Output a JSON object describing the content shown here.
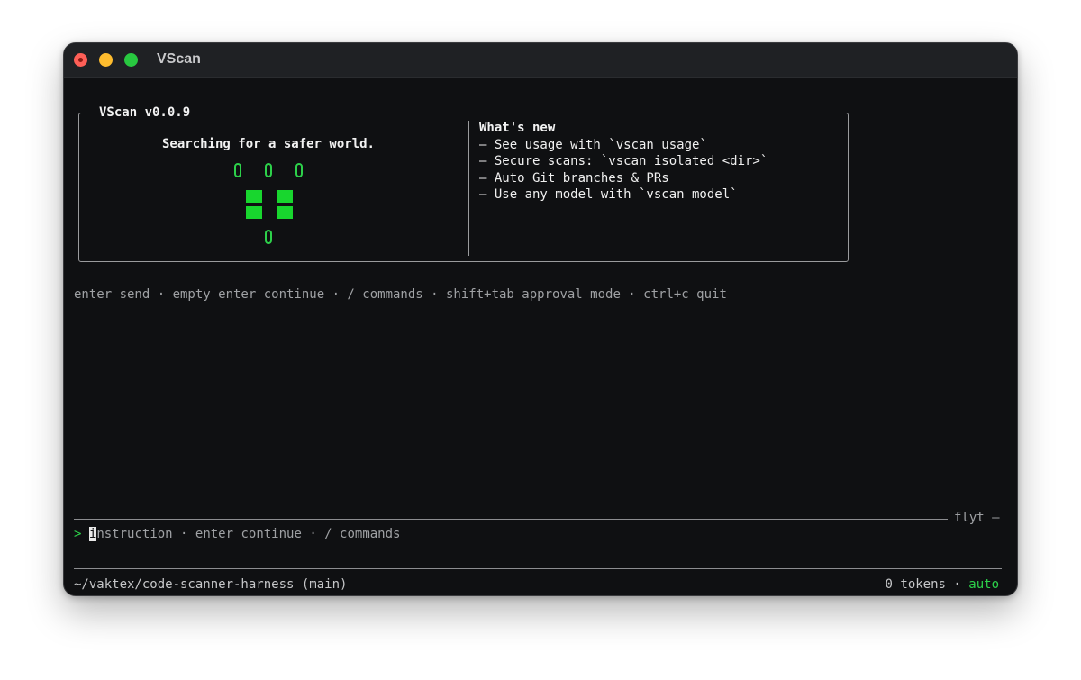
{
  "window": {
    "title": "VScan",
    "buttons": [
      "close",
      "minimize",
      "zoom"
    ]
  },
  "banner": {
    "title": "VScan v0.0.9",
    "tagline": "Searching for a safer world.",
    "logo": "robot-ascii-logo",
    "whats_new_title": "What's new",
    "whats_new_items": [
      "– See usage with `vscan usage`",
      "– Secure scans: `vscan isolated <dir>`",
      "– Auto Git branches & PRs",
      "– Use any model with `vscan model`"
    ]
  },
  "hints": "enter send · empty enter continue · / commands · shift+tab approval mode · ctrl+c quit",
  "input": {
    "label": "flyt —",
    "prompt": ">",
    "cursor_char": "i",
    "placeholder_rest": "nstruction · enter continue · / commands"
  },
  "status": {
    "path": "~/vaktex/code-scanner-harness (main)",
    "tokens": "0 tokens",
    "separator": "·",
    "mode": "auto"
  },
  "colors": {
    "background": "#0f1012",
    "accent_green": "#2dd14a",
    "text_dim": "#9fa1a4",
    "text_bright": "#f2f2f2"
  }
}
